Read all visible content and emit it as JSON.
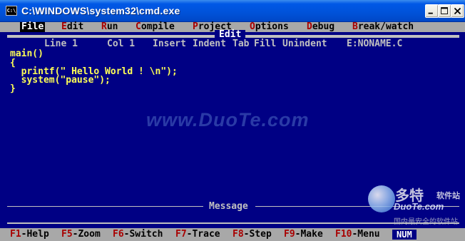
{
  "window": {
    "title": "C:\\WINDOWS\\system32\\cmd.exe",
    "icon": "C:\\"
  },
  "menu": {
    "file": "File",
    "edit": "Edit",
    "run": "Run",
    "compile": "Compile",
    "project": "Project",
    "options": "Options",
    "debug": "Debug",
    "break_watch": "Break/watch"
  },
  "menu_hotkeys": {
    "file": "F",
    "edit": "E",
    "run": "R",
    "compile": "C",
    "project": "P",
    "options": "O",
    "debug": "D",
    "break_watch": "B"
  },
  "menu_rest": {
    "file": "ile",
    "edit": "dit",
    "run": "un",
    "compile": "ompile",
    "project": "roject",
    "options": "ptions",
    "debug": "ebug",
    "break_watch": "reak/watch"
  },
  "editor": {
    "title": "Edit",
    "line": "Line 1",
    "col": "Col 1",
    "insert": "Insert",
    "indent": "Indent",
    "tab": "Tab",
    "fill": "Fill",
    "unindent": "Unindent",
    "filename": "E:NONAME.C",
    "code": [
      "main()",
      "{",
      "  printf(\" Hello World ! \\n\");",
      "  system(\"pause\");",
      "}"
    ]
  },
  "watermark": "www.DuoTe.com",
  "message": {
    "title": "Message"
  },
  "logo": {
    "cn": "多特",
    "cn_small": "软件站",
    "en": "DuoTe.com",
    "sub": "国内最安全的软件站"
  },
  "fkeys": [
    {
      "key": "F1",
      "label": "-Help"
    },
    {
      "key": "F5",
      "label": "-Zoom"
    },
    {
      "key": "F6",
      "label": "-Switch"
    },
    {
      "key": "F7",
      "label": "-Trace"
    },
    {
      "key": "F8",
      "label": "-Step"
    },
    {
      "key": "F9",
      "label": "-Make"
    },
    {
      "key": "F10",
      "label": "-Menu"
    }
  ],
  "num_indicator": "NUM",
  "colors": {
    "titlebar": "#0058e6",
    "editor_bg": "#000084",
    "menu_bg": "#a8a8a8",
    "code_text": "#ffff55",
    "hotkey": "#a80000"
  }
}
